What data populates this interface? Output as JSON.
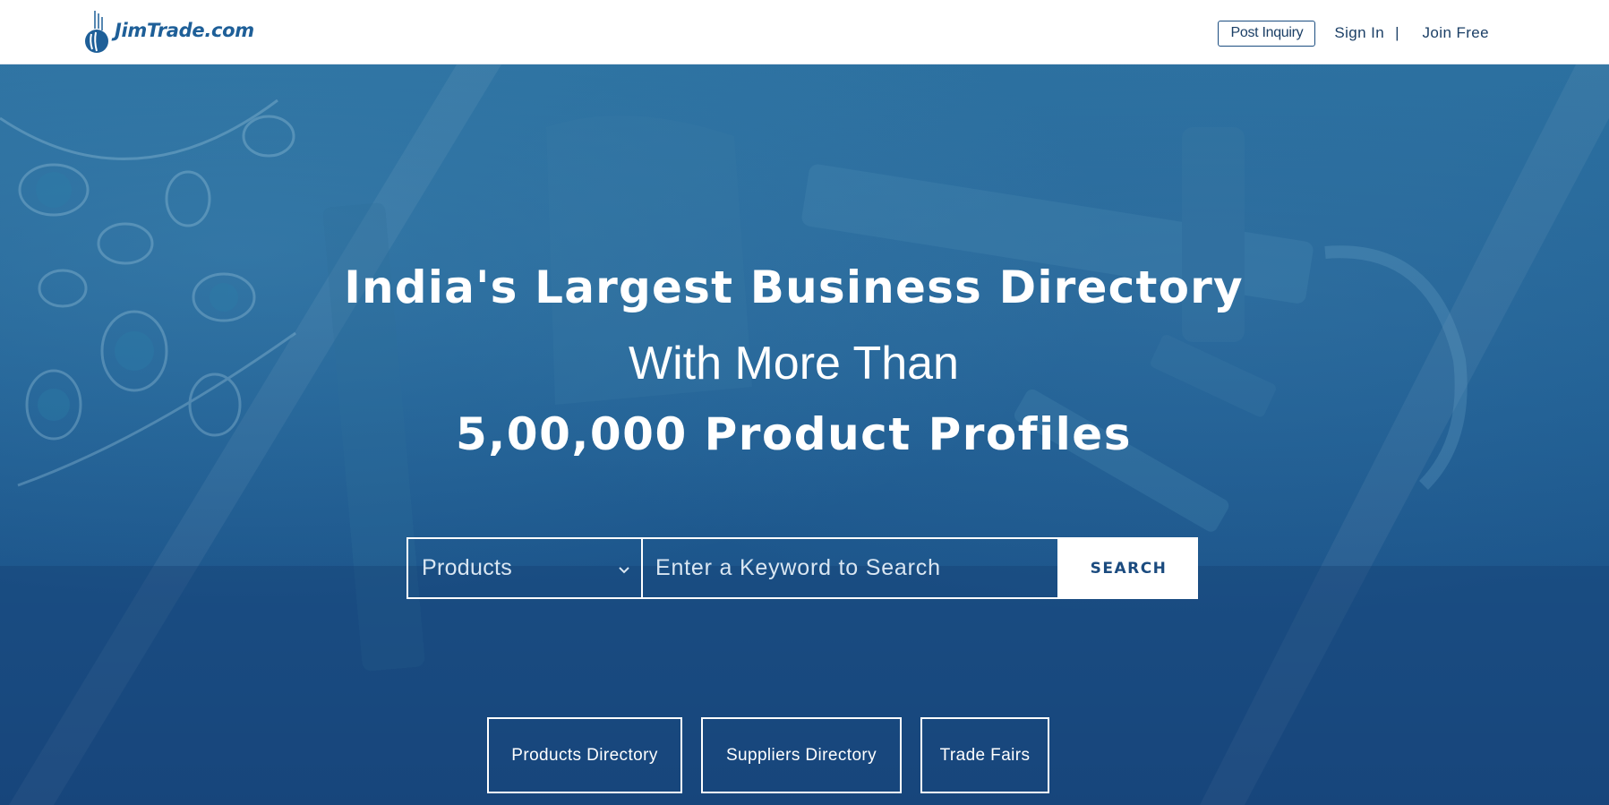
{
  "header": {
    "logo_text": "JimTrade.com",
    "post_inquiry": "Post Inquiry",
    "sign_in": "Sign In",
    "separator": "|",
    "join_free": "Join Free"
  },
  "hero": {
    "headline_1": "India's Largest Business Directory",
    "headline_2": "With More Than",
    "headline_3": "5,00,000 Product Profiles"
  },
  "search": {
    "category_selected": "Products",
    "keyword_placeholder": "Enter a Keyword to Search",
    "button_label": "SEARCH"
  },
  "quick_links": [
    {
      "label": "Products Directory"
    },
    {
      "label": "Suppliers Directory"
    },
    {
      "label": "Trade Fairs"
    }
  ],
  "colors": {
    "brand_blue": "#1e5f98",
    "hero_overlay": "#1f5e93",
    "white": "#ffffff"
  }
}
